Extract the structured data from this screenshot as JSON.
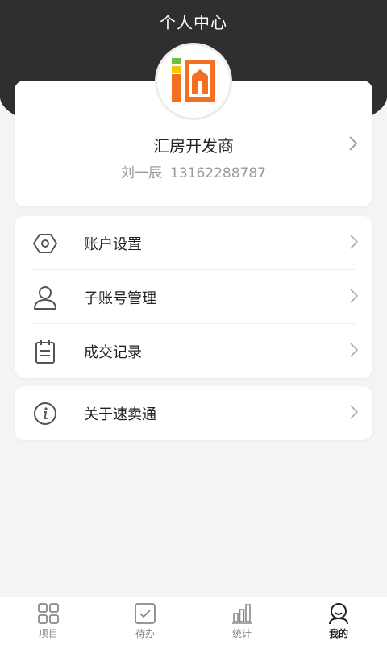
{
  "header": {
    "title": "个人中心"
  },
  "profile": {
    "company": "汇房开发商",
    "name": "刘一辰",
    "phone": "13162288787",
    "logo_icon": "company-logo",
    "logo_colors": {
      "orange": "#f36f21",
      "green": "#6cbf3f"
    }
  },
  "menu": {
    "group1": [
      {
        "label": "账户设置",
        "icon": "settings-hexagon-icon"
      },
      {
        "label": "子账号管理",
        "icon": "user-icon"
      },
      {
        "label": "成交记录",
        "icon": "clipboard-icon"
      }
    ],
    "group2": [
      {
        "label": "关于速卖通",
        "icon": "info-icon"
      }
    ]
  },
  "tabbar": {
    "items": [
      {
        "label": "项目",
        "icon": "grid-icon",
        "active": false
      },
      {
        "label": "待办",
        "icon": "checkbox-icon",
        "active": false
      },
      {
        "label": "统计",
        "icon": "bar-chart-icon",
        "active": false
      },
      {
        "label": "我的",
        "icon": "profile-icon",
        "active": true
      }
    ]
  },
  "colors": {
    "header_bg": "#2f2f2f",
    "page_bg": "#f4f4f4"
  }
}
